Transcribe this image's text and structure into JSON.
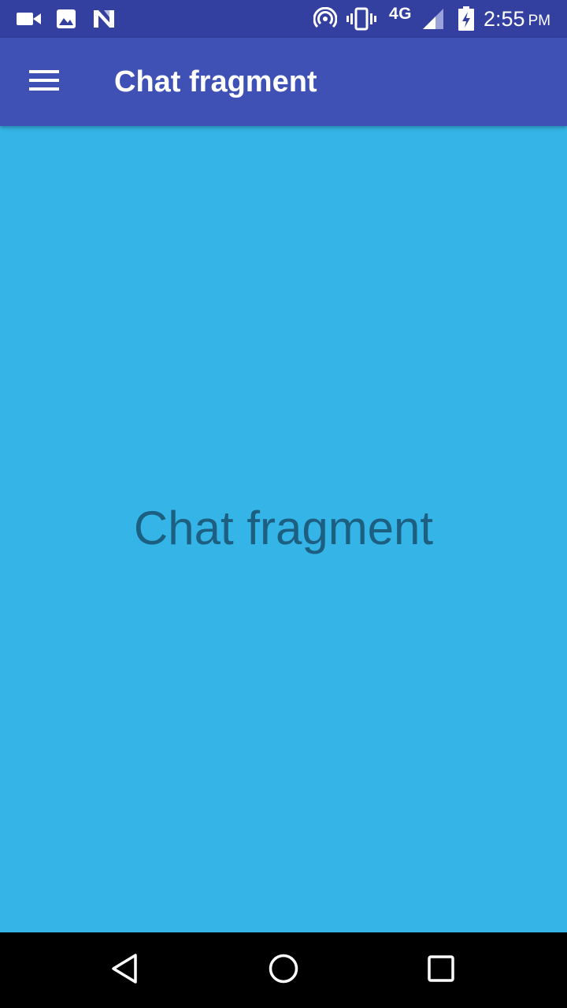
{
  "status_bar": {
    "icons": [
      "video-camera-icon",
      "image-icon",
      "n-app-icon",
      "hotspot-icon",
      "vibrate-icon",
      "signal-icon",
      "battery-charging-icon"
    ],
    "network_label": "4G",
    "time": "2:55",
    "ampm": "PM",
    "background_color": "#3340a0"
  },
  "app_bar": {
    "menu_icon": "hamburger-menu-icon",
    "title": "Chat fragment",
    "background_color": "#3f51b5"
  },
  "content": {
    "text": "Chat fragment",
    "background_color": "#35b5e7",
    "text_color": "#1c5f80"
  },
  "nav_bar": {
    "icons": [
      "back-icon",
      "home-icon",
      "recents-icon"
    ],
    "background_color": "#000000"
  }
}
